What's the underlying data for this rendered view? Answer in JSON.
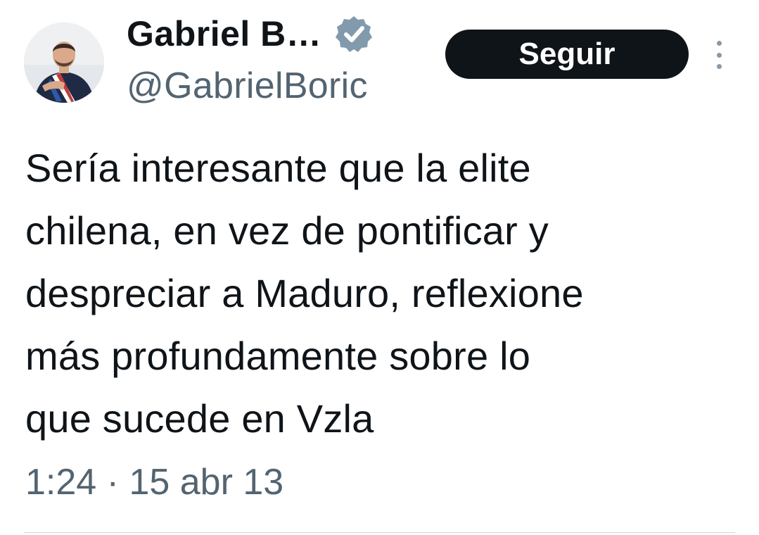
{
  "author": {
    "display_name": "Gabriel B…",
    "handle": "@GabrielBoric",
    "verified_icon": "verified-badge-icon",
    "avatar_icon": "profile-photo"
  },
  "actions": {
    "follow_label": "Seguir",
    "more_icon": "vertical-ellipsis-icon"
  },
  "tweet": {
    "lines": [
      "Sería interesante que la elite",
      "chilena, en vez de pontificar y",
      "despreciar a Maduro, reflexione",
      "más profundamente sobre lo",
      "que sucede en Vzla"
    ],
    "time": "1:24",
    "separator": "·",
    "date": "15 abr 13"
  },
  "colors": {
    "text_primary": "#0f1419",
    "text_secondary": "#536471",
    "button_bg": "#0f1419",
    "verified_badge": "#829aab",
    "divider": "#cfd9de"
  }
}
